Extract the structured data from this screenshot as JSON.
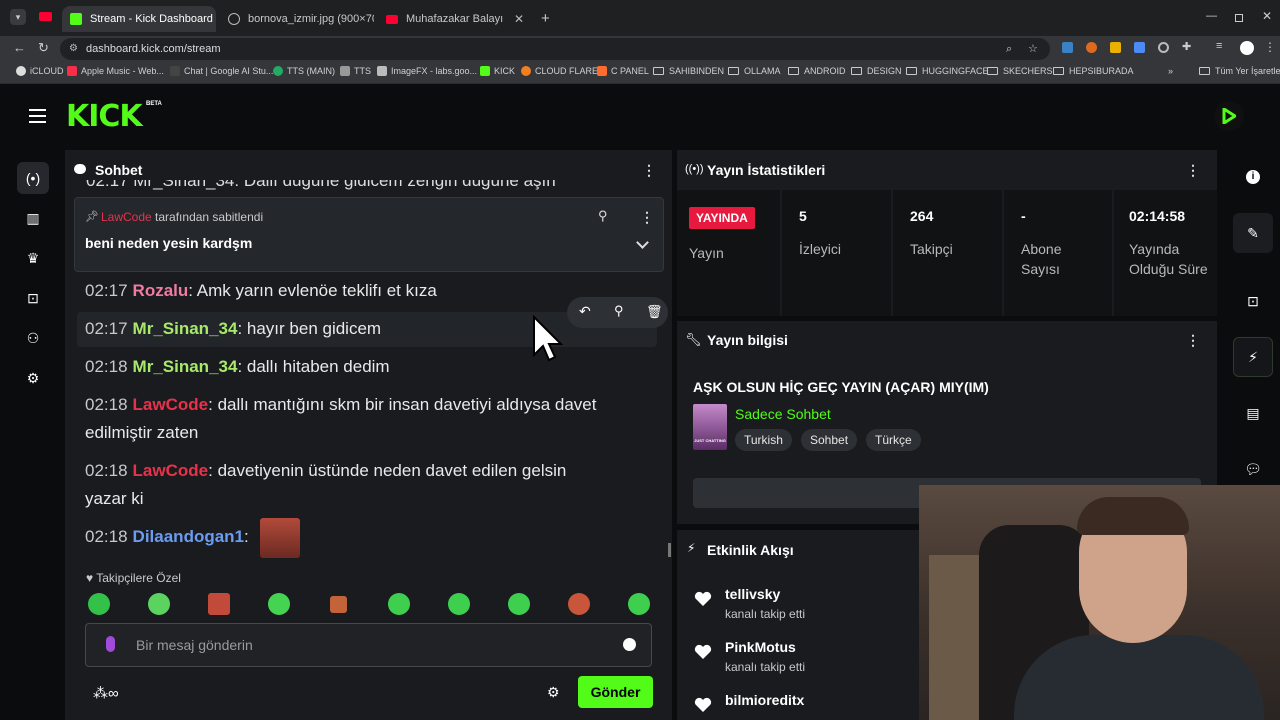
{
  "browser": {
    "tabs": [
      {
        "label": "Stream - Kick Dashboard"
      },
      {
        "label": "bornova_izmir.jpg (900×700)"
      },
      {
        "label": "Muhafazakar Balayı Villası İncel"
      }
    ],
    "url": "dashboard.kick.com/stream",
    "bookmarks": [
      "iCLOUD",
      "Apple Music - Web...",
      "Chat | Google AI Stu...",
      "TTS (MAIN)",
      "TTS",
      "ImageFX - labs.goo...",
      "KICK",
      "CLOUD FLARE",
      "C PANEL",
      "SAHIBINDEN",
      "OLLAMA",
      "ANDROID",
      "DESIGN",
      "HUGGINGFACE",
      "SKECHERS",
      "HEPSIBURADA"
    ],
    "all_bookmarks": "Tüm Yer İşaretleri",
    "more": "»"
  },
  "app": {
    "logo": "KICK",
    "beta": "BETA"
  },
  "chat": {
    "title": "Sohbet",
    "cut_line": "02:17 Mr_Sinan_34: Dallı düğüne gidicem zengin düğüne aşın",
    "pinned": {
      "by_user": "LawCode",
      "by_suffix": "tarafından sabitlendi",
      "text": "beni neden yesin kardşm"
    },
    "messages": [
      {
        "time": "02:17",
        "user": "Rozalu",
        "color": "#f07aa0",
        "text": "Amk yarın evlenöe teklifı et kıza"
      },
      {
        "time": "02:17",
        "user": "Mr_Sinan_34",
        "color": "#a8e86a",
        "text": "hayır ben gidicem"
      },
      {
        "time": "02:18",
        "user": "Mr_Sinan_34",
        "color": "#a8e86a",
        "text": "dallı hitaben dedim"
      },
      {
        "time": "02:18",
        "user": "LawCode",
        "color": "#e8324a",
        "text": "dallı mantığını skm bir insan davetiyi aldıysa davet",
        "text2": "edilmiştir zaten"
      },
      {
        "time": "02:18",
        "user": "LawCode",
        "color": "#e8324a",
        "text": "davetiyenin üstünde neden davet edilen gelsin",
        "text2": "yazar ki"
      },
      {
        "time": "02:18",
        "user": "Dilaandogan1",
        "color": "#6b9cf2",
        "text": ""
      }
    ],
    "followers_only": "Takipçilere Özel",
    "input_placeholder": "Bir mesaj gönderin",
    "send_label": "Gönder"
  },
  "stats": {
    "title": "Yayın İstatistikleri",
    "live_badge": "YAYINDA",
    "live_label": "Yayın",
    "cells": [
      {
        "value": "5",
        "label": "İzleyici"
      },
      {
        "value": "264",
        "label": "Takipçi"
      },
      {
        "value": "-",
        "label": "Abone Sayısı"
      },
      {
        "value": "02:14:58",
        "label": "Yayında Olduğu Süre"
      }
    ]
  },
  "info": {
    "title": "Yayın bilgisi",
    "stream_title": "AŞK OLSUN HİÇ GEÇ YAYIN (AÇAR) MIY(IM)",
    "category": "Sadece Sohbet",
    "category_thumb": "JUST CHATTING",
    "tags": [
      "Turkish",
      "Sohbet",
      "Türkçe"
    ]
  },
  "activity": {
    "title": "Etkinlik Akışı",
    "events": [
      {
        "user": "tellivsky",
        "action": "kanalı takip etti"
      },
      {
        "user": "PinkMotus",
        "action": "kanalı takip etti"
      },
      {
        "user": "bilmioreditx",
        "action": ""
      }
    ]
  },
  "colors": {
    "accent": "#53fc18",
    "live": "#e8193f",
    "panel": "#191b1f"
  }
}
